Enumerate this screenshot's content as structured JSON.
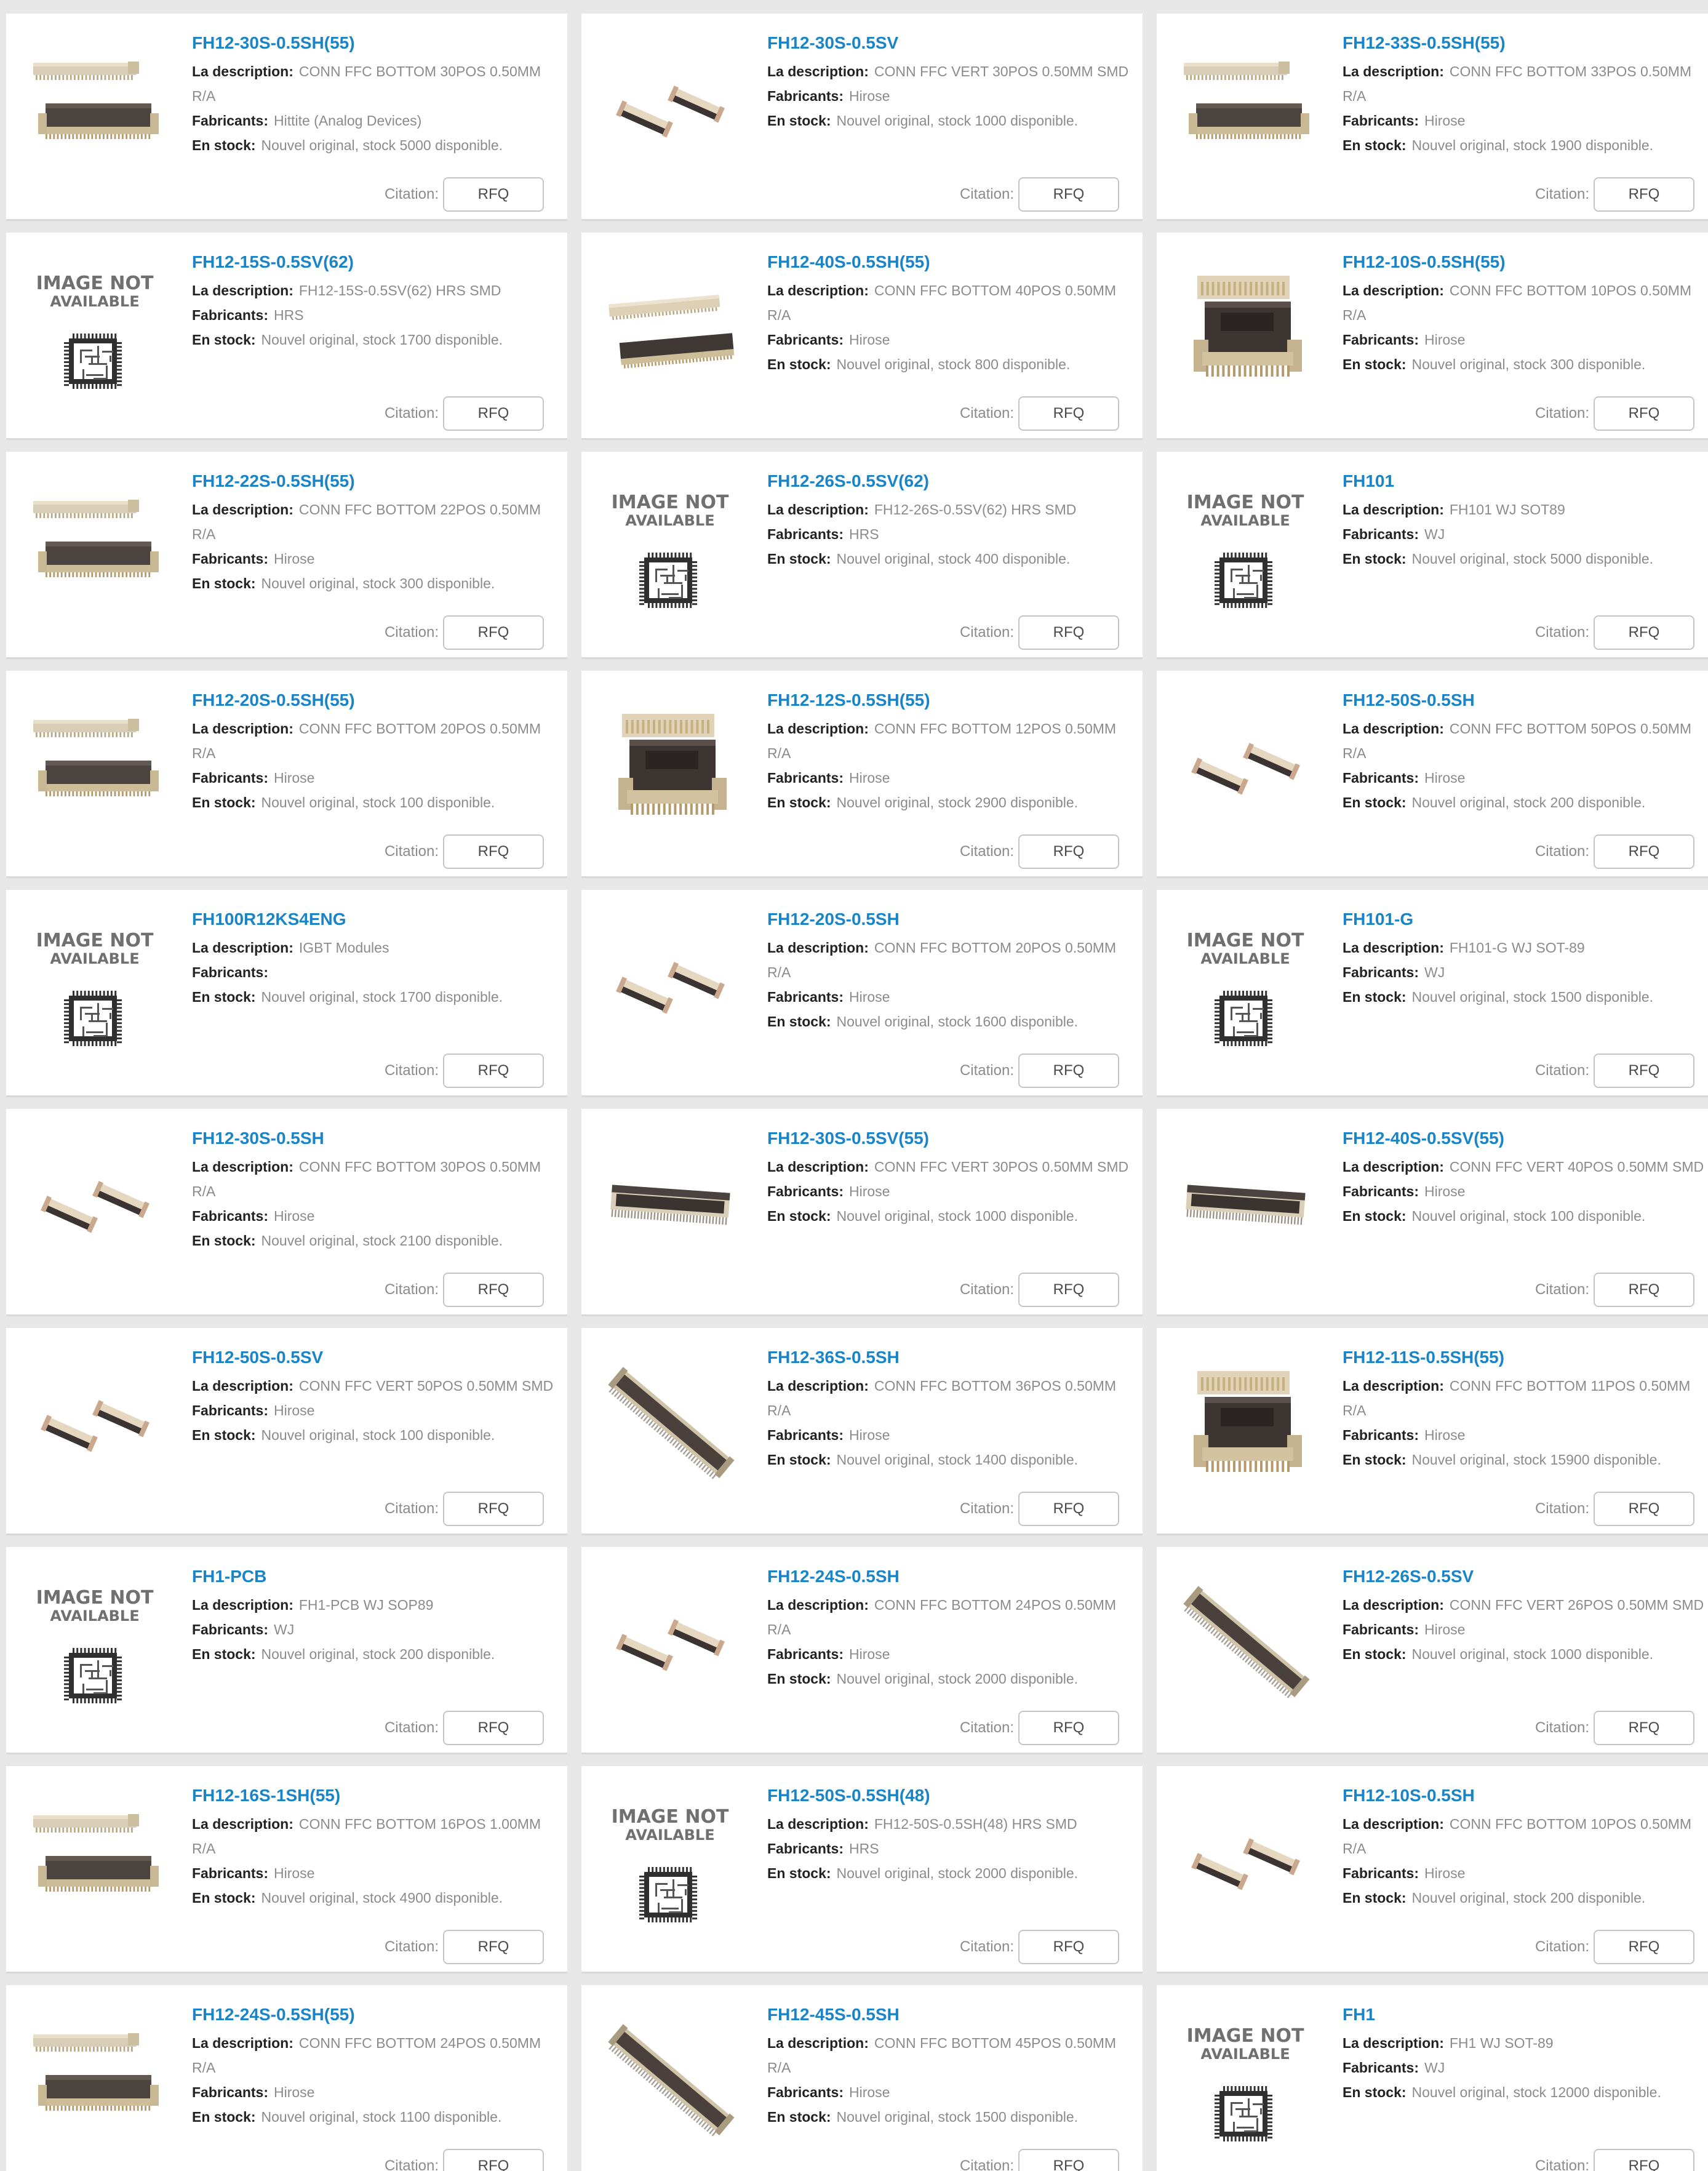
{
  "labels": {
    "description": "La description:",
    "manufacturer": "Fabricants:",
    "stock": "En stock:",
    "quote": "Citation:",
    "rfq": "RFQ",
    "na_line1": "IMAGE NOT",
    "na_line2": "AVAILABLE"
  },
  "colors": {
    "page_background": "#e7e7e7",
    "card_background": "#ffffff",
    "part_number_link": "#1a84c6",
    "label_text": "#222222",
    "value_text": "#8b8b8b"
  },
  "products": [
    {
      "part": "FH12-30S-0.5SH(55)",
      "desc": "CONN FFC BOTTOM 30POS 0.50MM R/A",
      "mfr": "Hittite (Analog Devices)",
      "stock": "Nouvel original, stock 5000 disponible.",
      "image": "fpc-bottom-pair"
    },
    {
      "part": "FH12-30S-0.5SV",
      "desc": "CONN FFC VERT 30POS 0.50MM SMD",
      "mfr": "Hirose",
      "stock": "Nouvel original, stock 1000 disponible.",
      "image": "fpc-small-pair"
    },
    {
      "part": "FH12-33S-0.5SH(55)",
      "desc": "CONN FFC BOTTOM 33POS 0.50MM R/A",
      "mfr": "Hirose",
      "stock": "Nouvel original, stock 1900 disponible.",
      "image": "fpc-bottom-pair"
    },
    {
      "part": "FH12-15S-0.5SV(62)",
      "desc": "FH12-15S-0.5SV(62) HRS   SMD",
      "mfr": "HRS",
      "stock": "Nouvel original, stock 1700 disponible.",
      "image": "not-available"
    },
    {
      "part": "FH12-40S-0.5SH(55)",
      "desc": "CONN FFC BOTTOM 40POS 0.50MM R/A",
      "mfr": "Hirose",
      "stock": "Nouvel original, stock 800 disponible.",
      "image": "fpc-long-pair"
    },
    {
      "part": "FH12-10S-0.5SH(55)",
      "desc": "CONN FFC BOTTOM 10POS 0.50MM R/A",
      "mfr": "Hirose",
      "stock": "Nouvel original, stock 300 disponible.",
      "image": "fpc-dark-block"
    },
    {
      "part": "FH12-22S-0.5SH(55)",
      "desc": "CONN FFC BOTTOM 22POS 0.50MM R/A",
      "mfr": "Hirose",
      "stock": "Nouvel original, stock 300 disponible.",
      "image": "fpc-bottom-pair"
    },
    {
      "part": "FH12-26S-0.5SV(62)",
      "desc": "FH12-26S-0.5SV(62) HRS   SMD",
      "mfr": "HRS",
      "stock": "Nouvel original, stock 400 disponible.",
      "image": "not-available"
    },
    {
      "part": "FH101",
      "desc": "FH101 WJ SOT89",
      "mfr": "WJ",
      "stock": "Nouvel original, stock 5000 disponible.",
      "image": "not-available"
    },
    {
      "part": "FH12-20S-0.5SH(55)",
      "desc": "CONN FFC BOTTOM 20POS 0.50MM R/A",
      "mfr": "Hirose",
      "stock": "Nouvel original, stock 100 disponible.",
      "image": "fpc-bottom-pair"
    },
    {
      "part": "FH12-12S-0.5SH(55)",
      "desc": "CONN FFC BOTTOM 12POS 0.50MM R/A",
      "mfr": "Hirose",
      "stock": "Nouvel original, stock 2900 disponible.",
      "image": "fpc-dark-block"
    },
    {
      "part": "FH12-50S-0.5SH",
      "desc": "CONN FFC BOTTOM 50POS 0.50MM R/A",
      "mfr": "Hirose",
      "stock": "Nouvel original, stock 200 disponible.",
      "image": "fpc-small-pair"
    },
    {
      "part": "FH100R12KS4ENG",
      "desc": "IGBT Modules",
      "mfr": "",
      "stock": "Nouvel original, stock 1700 disponible.",
      "image": "not-available"
    },
    {
      "part": "FH12-20S-0.5SH",
      "desc": "CONN FFC BOTTOM 20POS 0.50MM R/A",
      "mfr": "Hirose",
      "stock": "Nouvel original, stock 1600 disponible.",
      "image": "fpc-small-pair"
    },
    {
      "part": "FH101-G",
      "desc": "FH101-G WJ SOT-89",
      "mfr": "WJ",
      "stock": "Nouvel original, stock 1500 disponible.",
      "image": "not-available"
    },
    {
      "part": "FH12-30S-0.5SH",
      "desc": "CONN FFC BOTTOM 30POS 0.50MM R/A",
      "mfr": "Hirose",
      "stock": "Nouvel original, stock 2100 disponible.",
      "image": "fpc-small-pair"
    },
    {
      "part": "FH12-30S-0.5SV(55)",
      "desc": "CONN FFC VERT 30POS 0.50MM SMD",
      "mfr": "Hirose",
      "stock": "Nouvel original, stock 1000 disponible.",
      "image": "fpc-vert-strip"
    },
    {
      "part": "FH12-40S-0.5SV(55)",
      "desc": "CONN FFC VERT 40POS 0.50MM SMD",
      "mfr": "Hirose",
      "stock": "Nouvel original, stock 100 disponible.",
      "image": "fpc-vert-strip"
    },
    {
      "part": "FH12-50S-0.5SV",
      "desc": "CONN FFC VERT 50POS 0.50MM SMD",
      "mfr": "Hirose",
      "stock": "Nouvel original, stock 100 disponible.",
      "image": "fpc-small-pair"
    },
    {
      "part": "FH12-36S-0.5SH",
      "desc": "CONN FFC BOTTOM 36POS 0.50MM R/A",
      "mfr": "Hirose",
      "stock": "Nouvel original, stock 1400 disponible.",
      "image": "fpc-diagonal"
    },
    {
      "part": "FH12-11S-0.5SH(55)",
      "desc": "CONN FFC BOTTOM 11POS 0.50MM R/A",
      "mfr": "Hirose",
      "stock": "Nouvel original, stock 15900 disponible.",
      "image": "fpc-dark-block"
    },
    {
      "part": "FH1-PCB",
      "desc": "FH1-PCB WJ SOP89",
      "mfr": "WJ",
      "stock": "Nouvel original, stock 200 disponible.",
      "image": "not-available"
    },
    {
      "part": "FH12-24S-0.5SH",
      "desc": "CONN FFC BOTTOM 24POS 0.50MM R/A",
      "mfr": "Hirose",
      "stock": "Nouvel original, stock 2000 disponible.",
      "image": "fpc-small-pair"
    },
    {
      "part": "FH12-26S-0.5SV",
      "desc": "CONN FFC VERT 26POS 0.50MM SMD",
      "mfr": "Hirose",
      "stock": "Nouvel original, stock 1000 disponible.",
      "image": "fpc-diagonal"
    },
    {
      "part": "FH12-16S-1SH(55)",
      "desc": "CONN FFC BOTTOM 16POS 1.00MM R/A",
      "mfr": "Hirose",
      "stock": "Nouvel original, stock 4900 disponible.",
      "image": "fpc-bottom-pair"
    },
    {
      "part": "FH12-50S-0.5SH(48)",
      "desc": "FH12-50S-0.5SH(48) HRS SMD",
      "mfr": "HRS",
      "stock": "Nouvel original, stock 2000 disponible.",
      "image": "not-available"
    },
    {
      "part": "FH12-10S-0.5SH",
      "desc": "CONN FFC BOTTOM 10POS 0.50MM R/A",
      "mfr": "Hirose",
      "stock": "Nouvel original, stock 200 disponible.",
      "image": "fpc-small-pair"
    },
    {
      "part": "FH12-24S-0.5SH(55)",
      "desc": "CONN FFC BOTTOM 24POS 0.50MM R/A",
      "mfr": "Hirose",
      "stock": "Nouvel original, stock 1100 disponible.",
      "image": "fpc-bottom-pair"
    },
    {
      "part": "FH12-45S-0.5SH",
      "desc": "CONN FFC BOTTOM 45POS 0.50MM R/A",
      "mfr": "Hirose",
      "stock": "Nouvel original, stock 1500 disponible.",
      "image": "fpc-diagonal"
    },
    {
      "part": "FH1",
      "desc": "FH1 WJ SOT-89",
      "mfr": "WJ",
      "stock": "Nouvel original, stock 12000 disponible.",
      "image": "not-available"
    }
  ]
}
